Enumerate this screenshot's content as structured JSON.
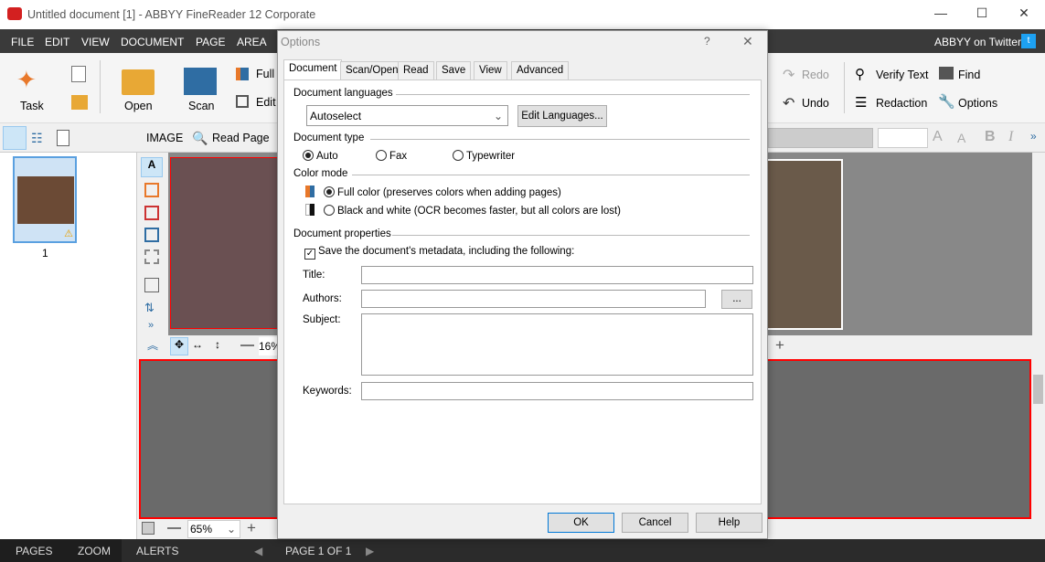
{
  "window": {
    "title": "Untitled document [1] - ABBYY FineReader 12 Corporate",
    "min": "—",
    "max": "☐",
    "close": "✕"
  },
  "menu": {
    "items": [
      "FILE",
      "EDIT",
      "VIEW",
      "DOCUMENT",
      "PAGE",
      "AREA"
    ],
    "twitter": "ABBYY on Twitter:"
  },
  "ribbon": {
    "task": "Task",
    "open": "Open",
    "scan": "Scan",
    "full": "Full",
    "edit": "Edit",
    "redo": "Redo",
    "undo": "Undo",
    "verify": "Verify Text",
    "redaction": "Redaction",
    "find": "Find",
    "options": "Options"
  },
  "toolbar2": {
    "image": "IMAGE",
    "read_page": "Read Page"
  },
  "pages": {
    "thumb_number": "1"
  },
  "viewer": {
    "top_zoom": "16%",
    "bottom_zoom": "65%"
  },
  "status": {
    "pages": "PAGES",
    "zoom": "ZOOM",
    "alerts": "ALERTS",
    "page": "PAGE 1 OF 1"
  },
  "dialog": {
    "title": "Options",
    "help": "?",
    "close": "✕",
    "tabs": [
      "Document",
      "Scan/Open",
      "Read",
      "Save",
      "View",
      "Advanced"
    ],
    "doc_languages": "Document languages",
    "lang_value": "Autoselect",
    "edit_languages": "Edit Languages...",
    "doc_type": "Document type",
    "types": [
      "Auto",
      "Fax",
      "Typewriter"
    ],
    "type_selected": "Auto",
    "color_mode": "Color mode",
    "full_color": "Full color (preserves colors when adding pages)",
    "bw": "Black and white (OCR becomes faster, but all colors are lost)",
    "doc_props": "Document properties",
    "save_meta": "Save the document's metadata, including the following:",
    "save_meta_checked": true,
    "title_label": "Title:",
    "authors_label": "Authors:",
    "authors_btn": "...",
    "subject_label": "Subject:",
    "keywords_label": "Keywords:",
    "title_value": "",
    "authors_value": "",
    "subject_value": "",
    "keywords_value": "",
    "ok": "OK",
    "cancel": "Cancel",
    "help_btn": "Help"
  },
  "colors": {
    "menubar": "#3a3a3a",
    "accent": "#e8a835",
    "area_border": "#ff0000",
    "twitter": "#1da1f2"
  }
}
